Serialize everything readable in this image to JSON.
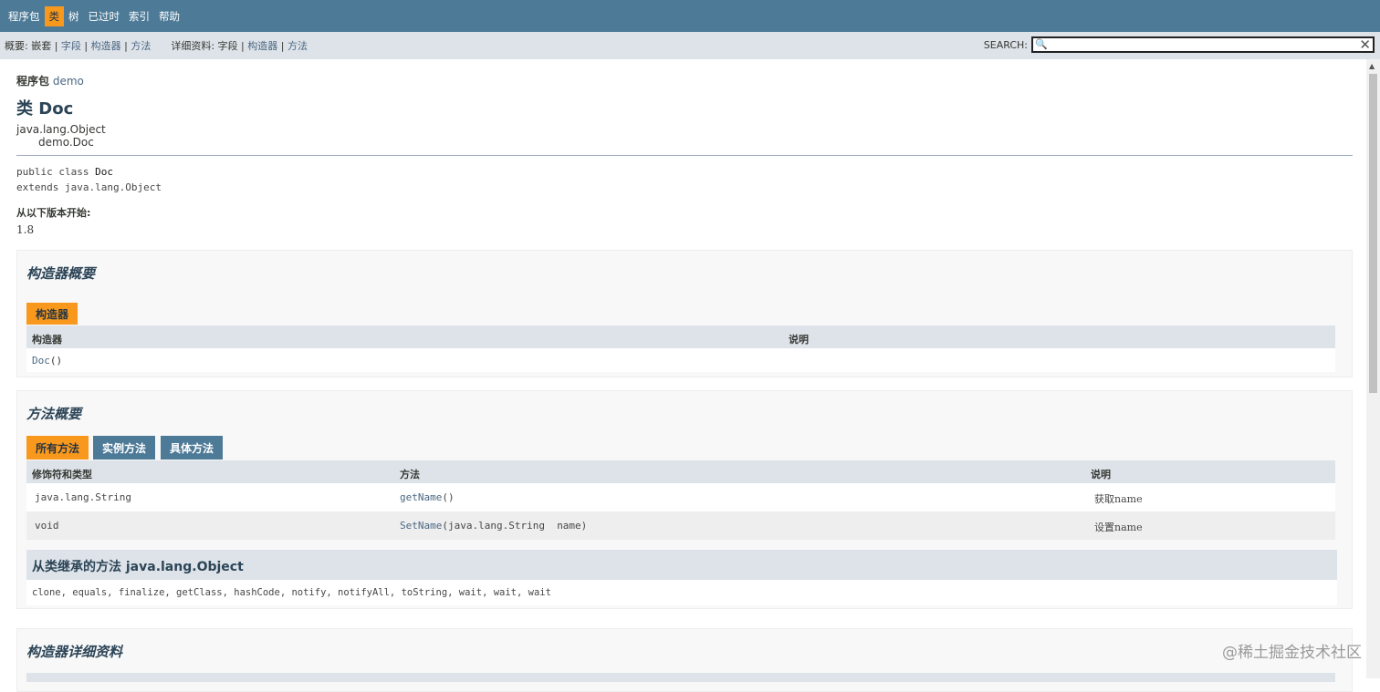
{
  "topnav": {
    "items": [
      "程序包",
      "类",
      "树",
      "已过时",
      "索引",
      "帮助"
    ],
    "active_index": 1
  },
  "subnav": {
    "summary_label": "概要:",
    "summary_items": [
      "嵌套",
      "字段",
      "构造器",
      "方法"
    ],
    "detail_label": "详细资料:",
    "detail_items": [
      "字段",
      "构造器",
      "方法"
    ],
    "search_label": "SEARCH:",
    "search_value": ""
  },
  "header": {
    "package_label": "程序包",
    "package_name": "demo",
    "class_title": "类 Doc",
    "inherit_parent": "java.lang.Object",
    "inherit_child": "demo.Doc",
    "sig_line1_prefix": "public class ",
    "sig_line1_name": "Doc",
    "sig_line2": "extends java.lang.Object",
    "since_label": "从以下版本开始:",
    "since_value": "1.8"
  },
  "constructor_summary": {
    "heading": "构造器概要",
    "tab": "构造器",
    "col_constructor": "构造器",
    "col_desc": "说明",
    "rows": [
      {
        "name": "Doc",
        "params": "()",
        "desc": ""
      }
    ]
  },
  "method_summary": {
    "heading": "方法概要",
    "tabs": [
      "所有方法",
      "实例方法",
      "具体方法"
    ],
    "active_tab": 0,
    "col_modifier": "修饰符和类型",
    "col_method": "方法",
    "col_desc": "说明",
    "rows": [
      {
        "type": "java.lang.String",
        "name": "getName",
        "params": "()",
        "desc": "获取name"
      },
      {
        "type": "void",
        "name": "SetName",
        "params": "(java.lang.String  name)",
        "desc": "设置name"
      }
    ],
    "inherited_heading": "从类继承的方法 java.lang.Object",
    "inherited_list": "clone, equals, finalize, getClass, hashCode, notify, notifyAll, toString, wait, wait, wait"
  },
  "constructor_detail": {
    "heading": "构造器详细资料"
  },
  "watermark": "@稀土掘金技术社区",
  "colors": {
    "nav_bg": "#4d7a97",
    "accent": "#f8981d",
    "subnav_bg": "#dee3e9"
  }
}
